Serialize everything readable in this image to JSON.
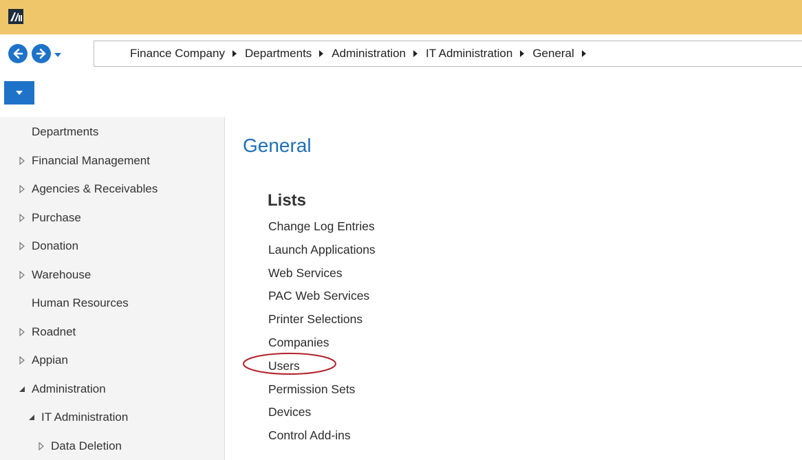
{
  "breadcrumb": [
    "Finance Company",
    "Departments",
    "Administration",
    "IT Administration",
    "General"
  ],
  "sidebar": {
    "items": [
      {
        "label": "Departments",
        "arrow": "none",
        "indent": 0
      },
      {
        "label": "Financial Management",
        "arrow": "collapsed",
        "indent": 0
      },
      {
        "label": "Agencies & Receivables",
        "arrow": "collapsed",
        "indent": 0
      },
      {
        "label": "Purchase",
        "arrow": "collapsed",
        "indent": 0
      },
      {
        "label": "Donation",
        "arrow": "collapsed",
        "indent": 0
      },
      {
        "label": "Warehouse",
        "arrow": "collapsed",
        "indent": 0
      },
      {
        "label": "Human Resources",
        "arrow": "none",
        "indent": 0
      },
      {
        "label": "Roadnet",
        "arrow": "collapsed",
        "indent": 0
      },
      {
        "label": "Appian",
        "arrow": "collapsed",
        "indent": 0
      },
      {
        "label": "Administration",
        "arrow": "expanded",
        "indent": 0
      },
      {
        "label": "IT Administration",
        "arrow": "expanded",
        "indent": 1
      },
      {
        "label": "Data Deletion",
        "arrow": "collapsed",
        "indent": 2
      }
    ]
  },
  "main": {
    "title": "General",
    "section_heading": "Lists",
    "links": [
      "Change Log Entries",
      "Launch Applications",
      "Web Services",
      "PAC Web Services",
      "Printer Selections",
      "Companies",
      "Users",
      "Permission Sets",
      "Devices",
      "Control Add-ins"
    ],
    "highlighted_link": "Users"
  },
  "colors": {
    "titlebar": "#f0c66a",
    "accent": "#1e73c8",
    "title_text": "#1e6fb8",
    "highlight_oval": "#b3202a"
  }
}
